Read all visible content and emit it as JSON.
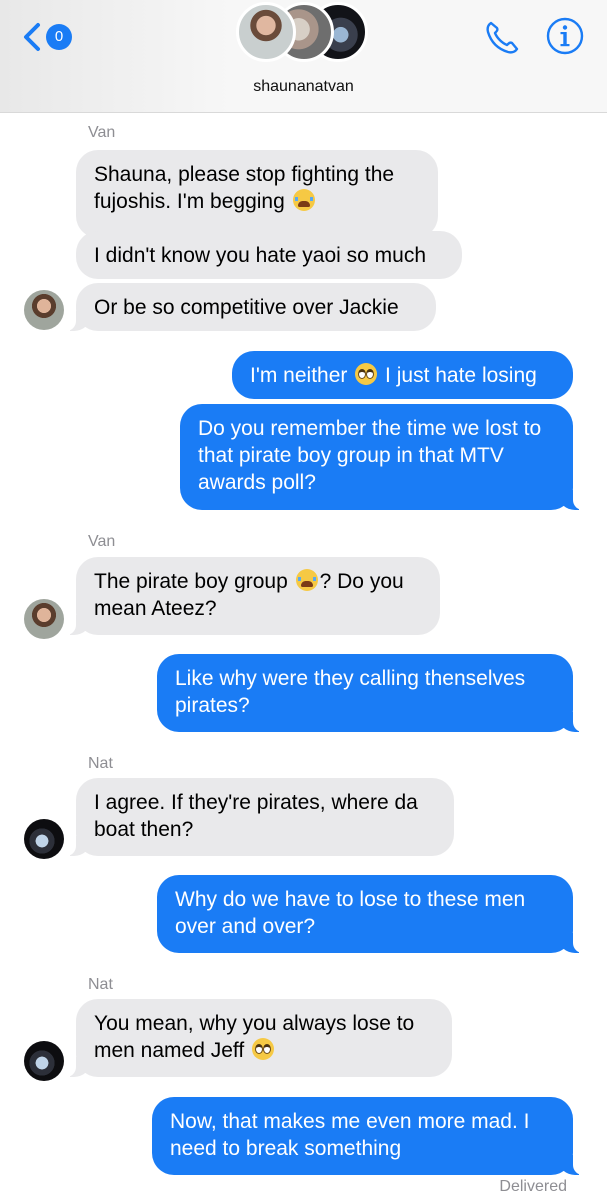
{
  "header": {
    "back_badge_count": "0",
    "conversation_name": "shaunanatvan",
    "accent_color": "#1a7cf5",
    "icons": [
      "chevron-left-icon",
      "phone-icon",
      "info-icon"
    ]
  },
  "messages": [
    {
      "sender_label": "Van"
    },
    {
      "text_before": "Shauna, please stop fighting the fujoshis. I'm begging ",
      "emoji": "loudly-crying-face",
      "text_after": ""
    },
    {
      "text": "I didn't know you hate yaoi so much"
    },
    {
      "text": "Or be so competitive over Jackie"
    },
    {
      "text_before": "I'm neither ",
      "emoji": "face-with-rolling-eyes",
      "text_after": " I just hate losing"
    },
    {
      "text": "Do you remember the time we lost to that pirate boy group in that MTV awards poll?"
    },
    {
      "sender_label": "Van"
    },
    {
      "text_before": "The pirate boy group ",
      "emoji": "loudly-crying-face",
      "text_after": "? Do you mean Ateez?"
    },
    {
      "text": "Like why were they calling thenselves pirates?"
    },
    {
      "sender_label": "Nat"
    },
    {
      "text": "I agree. If they're pirates, where da boat then?"
    },
    {
      "text": "Why do we have to lose to these men over and over?"
    },
    {
      "sender_label": "Nat"
    },
    {
      "text_before": "You mean, why you always lose to men named Jeff ",
      "emoji": "face-with-rolling-eyes",
      "text_after": ""
    },
    {
      "text": "Now, that makes me even more mad. I need to break something"
    },
    {
      "status": "Delivered"
    }
  ]
}
